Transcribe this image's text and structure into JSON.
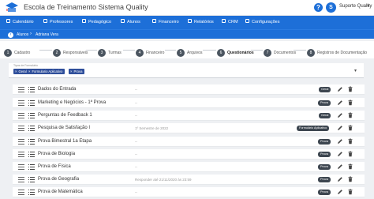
{
  "app": {
    "title": "Escola de Treinamento Sistema Quality",
    "help_glyph": "?",
    "user_initial": "S",
    "user_name": "Suporte Quality",
    "caret": "▾"
  },
  "nav": [
    {
      "label": "Calendário"
    },
    {
      "label": "Professores"
    },
    {
      "label": "Pedagógico"
    },
    {
      "label": "Alunos"
    },
    {
      "label": "Financeiro"
    },
    {
      "label": "Relatórios"
    },
    {
      "label": "CRM"
    },
    {
      "label": "Configurações"
    }
  ],
  "breadcrumb": {
    "back_glyph": "‹",
    "items": [
      "Alunos",
      "Adriana Vera"
    ],
    "separator": "›"
  },
  "steps": [
    {
      "num": "1",
      "label": "Cadastro"
    },
    {
      "num": "2",
      "label": "Responsáveis"
    },
    {
      "num": "3",
      "label": "Turmas"
    },
    {
      "num": "4",
      "label": "Financeiro"
    },
    {
      "num": "5",
      "label": "Arquivos"
    },
    {
      "num": "6",
      "label": "Questionários",
      "active": true
    },
    {
      "num": "7",
      "label": "Documentos"
    },
    {
      "num": "8",
      "label": "Registros de Documentação"
    }
  ],
  "filter": {
    "label": "Tipos de Formulário",
    "chips": [
      "Geral",
      "Formulario Aplicativo",
      "Prova"
    ],
    "remove_glyph": "×"
  },
  "forms": [
    {
      "name": "Dados do Entrada",
      "info": "--",
      "badge": "Geral"
    },
    {
      "name": "Marketing e Negócios - 1ª Prova",
      "info": "--",
      "badge": "Prova"
    },
    {
      "name": "Perguntas de Feedback 1",
      "info": "--",
      "badge": "Geral"
    },
    {
      "name": "Pesquisa de Satisfação I",
      "info": "1º Semestre de 2022",
      "badge": "Formulário Aplicativo"
    },
    {
      "name": "Prova Bimestral 1a Etapa",
      "info": "--",
      "badge": "Prova"
    },
    {
      "name": "Prova de Biologia",
      "info": "--",
      "badge": "Prova"
    },
    {
      "name": "Prova de Física",
      "info": "--",
      "badge": "Prova"
    },
    {
      "name": "Prova de Geografia",
      "info": "Responder até 21/11/2020 às 23:59",
      "badge": "Prova"
    },
    {
      "name": "Prova de Matemática",
      "info": "--",
      "badge": "Prova"
    }
  ],
  "colors": {
    "primary": "#1d6fd8",
    "badge": "#3d4650",
    "chip": "#2f4f9b"
  },
  "icons": [
    "drag-handle-icon",
    "list-icon",
    "pencil-icon",
    "trash-icon",
    "chevron-left-icon",
    "help-icon"
  ]
}
